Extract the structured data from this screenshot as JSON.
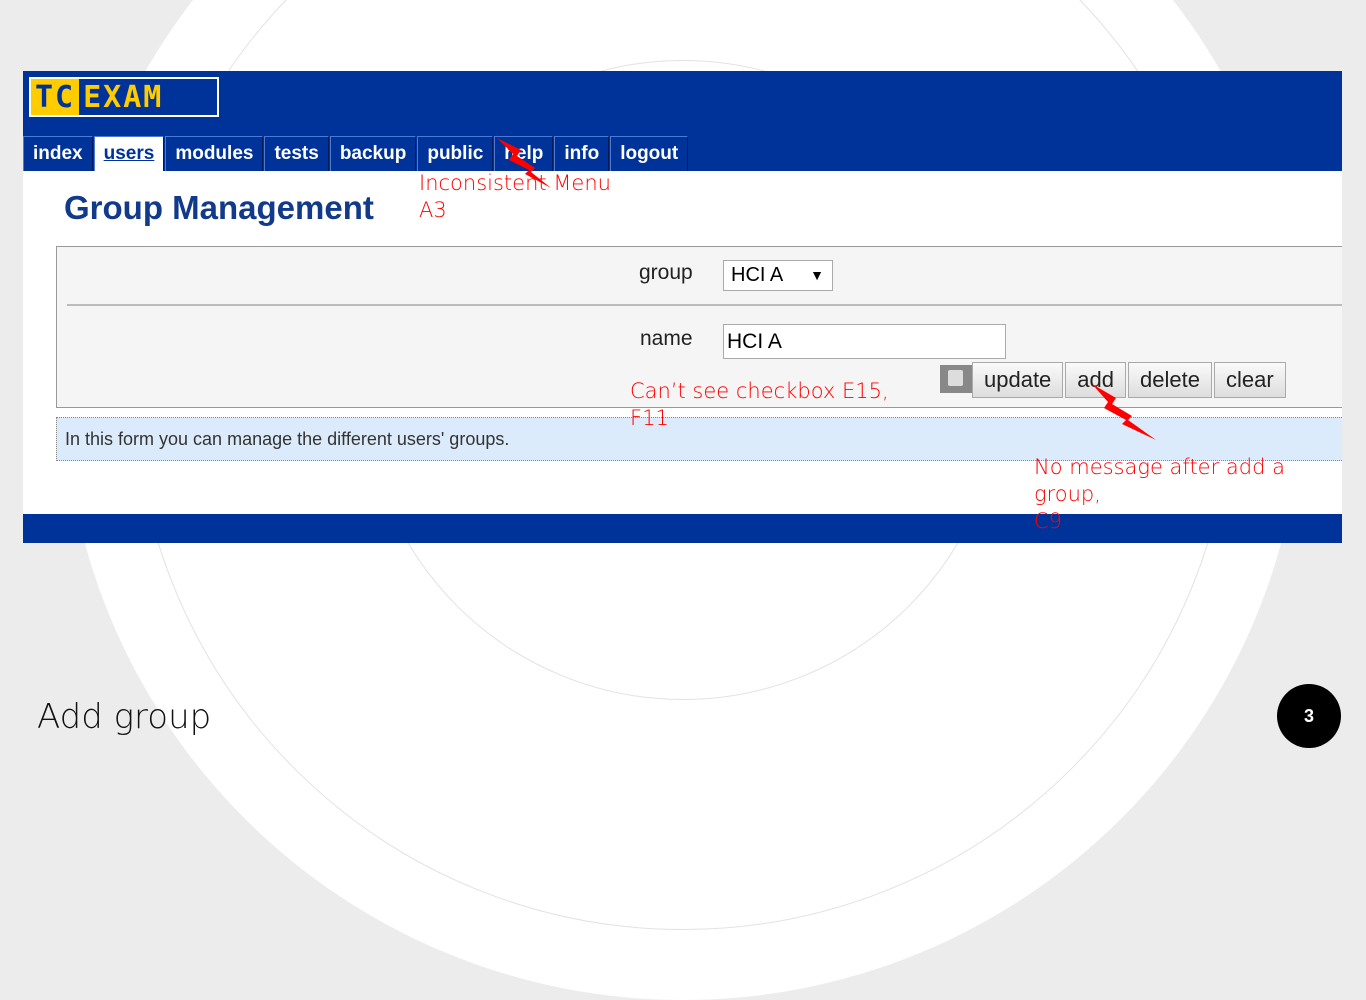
{
  "app": {
    "logo_text": "TCEXAM",
    "logo_tc": "TC",
    "logo_exam": "EXAM"
  },
  "menu": [
    {
      "label": "index"
    },
    {
      "label": "users",
      "active": true
    },
    {
      "label": "modules"
    },
    {
      "label": "tests"
    },
    {
      "label": "backup"
    },
    {
      "label": "public"
    },
    {
      "label": "help"
    },
    {
      "label": "info"
    },
    {
      "label": "logout"
    }
  ],
  "page": {
    "title": "Group Management"
  },
  "form": {
    "group_label": "group",
    "group_value": "HCI A",
    "dropdown_arrow": "▼",
    "name_label": "name",
    "name_value": "HCI A",
    "buttons": {
      "update": "update",
      "add": "add",
      "delete": "delete",
      "clear": "clear"
    }
  },
  "info_text": "In this form you can manage the different users' groups.",
  "annotations": {
    "menu_line1": "Inconsistent Menu",
    "menu_line2": "A3",
    "checkbox_line1": "Can’t see checkbox E15,",
    "checkbox_line2": "F11",
    "message_line1": "No message after add a",
    "message_line2": "group,",
    "message_line3": "C9"
  },
  "slide": {
    "title": "Add group",
    "page_number": "3"
  },
  "colors": {
    "brand_blue": "#003399",
    "logo_yellow": "#ffcc00",
    "annotation_red": "#ff0000"
  }
}
